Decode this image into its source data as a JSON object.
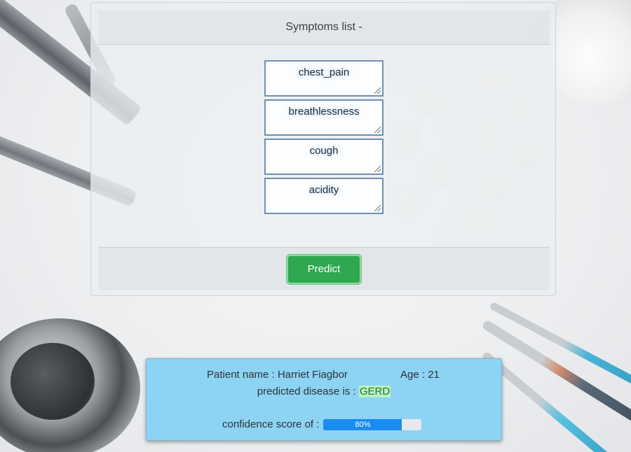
{
  "symptoms_card": {
    "title": "Symptoms list -",
    "symptoms": [
      "chest_pain",
      "breathlessness",
      "cough",
      "acidity"
    ],
    "predict_label": "Predict"
  },
  "result": {
    "patient_label": "Patient name : Harriet Fiagbor",
    "age_label": "Age : 21",
    "disease_prefix": "predicted disease is :",
    "disease": "GERD",
    "confidence_label": "confidence score of :",
    "confidence_text": "80%",
    "confidence_value": 0.8
  },
  "colors": {
    "predict_button": "#2fa84f",
    "result_panel": "#8dd3f3",
    "progress_fill": "#1a8cf0"
  }
}
